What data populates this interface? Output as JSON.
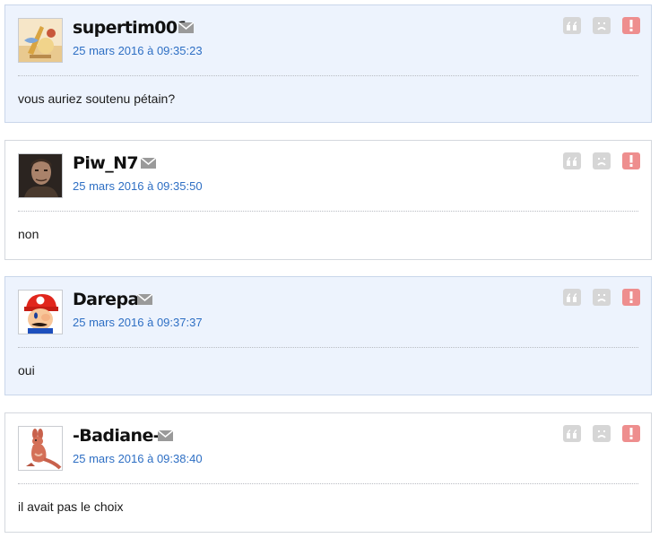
{
  "posts": [
    {
      "author": "supertim001",
      "date": "25 mars 2016 à 09:35:23",
      "message": "vous auriez soutenu pétain?",
      "avatar_icon": "food-illustration-avatar"
    },
    {
      "author": "Piw_N7",
      "date": "25 mars 2016 à 09:35:50",
      "message": "non",
      "avatar_icon": "man-portrait-avatar"
    },
    {
      "author": "Darepa",
      "date": "25 mars 2016 à 09:37:37",
      "message": "oui",
      "avatar_icon": "mario-avatar"
    },
    {
      "author": "-Badiane-",
      "date": "25 mars 2016 à 09:38:40",
      "message": "il avait pas le choix",
      "avatar_icon": "kangaroo-avatar"
    }
  ],
  "icons": {
    "mail": "envelope-icon",
    "quote": "quote-icon",
    "ignore": "sad-face-icon",
    "report": "exclamation-icon"
  },
  "colors": {
    "alt_background": "#edf3fd",
    "date_link": "#2e6fc4",
    "report_red": "#ee8e8e",
    "action_grey": "#d6d6d6"
  }
}
